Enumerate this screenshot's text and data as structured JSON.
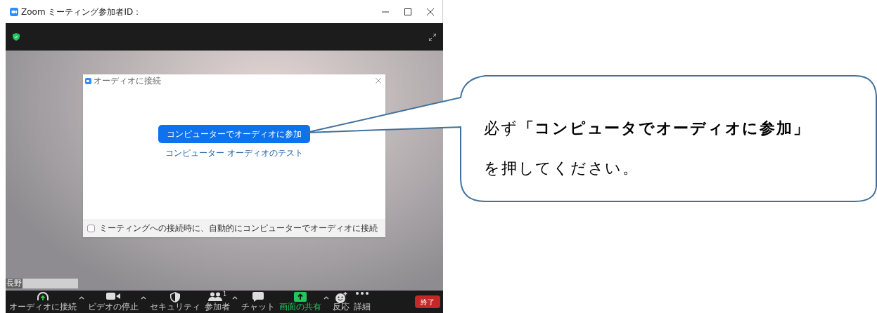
{
  "window": {
    "title": "Zoom ミーティング参加者ID："
  },
  "dialog": {
    "title": "オーディオに接続",
    "join_button": "コンピューターでオーディオに参加",
    "test_link": "コンピューター オーディオのテスト",
    "auto_connect": {
      "label": "ミーティングへの接続時に、自動的にコンピューターでオーディオに接続",
      "checked": false
    }
  },
  "participant_name": "長野",
  "toolbar": [
    {
      "label": "オーディオに接続",
      "kind": "headphones",
      "caret": true
    },
    {
      "label": "ビデオの停止",
      "kind": "video",
      "caret": true
    },
    {
      "label": "セキュリティ",
      "kind": "shield",
      "caret": false
    },
    {
      "label": "参加者",
      "kind": "people",
      "count": "1",
      "caret": true
    },
    {
      "label": "チャット",
      "kind": "chat",
      "caret": false
    },
    {
      "label": "画面の共有",
      "kind": "share",
      "caret": true
    },
    {
      "label": "反応",
      "kind": "smile",
      "caret": false
    },
    {
      "label": "詳細",
      "kind": "more",
      "caret": false
    }
  ],
  "end_button": "終了",
  "callout": {
    "text": "必ず**「コンピュータでオーディオに参加」**を押してください。"
  }
}
